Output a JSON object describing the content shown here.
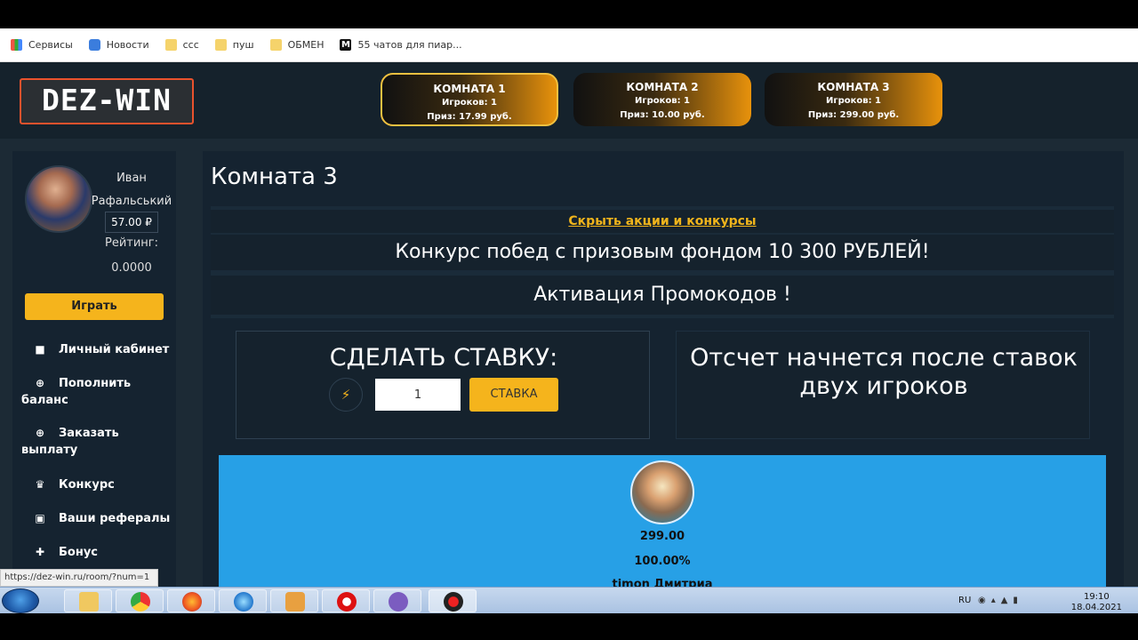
{
  "bookmarks": [
    {
      "label": "Сервисы",
      "icon": "apps-grid-icon"
    },
    {
      "label": "Новости",
      "icon": "news-icon"
    },
    {
      "label": "ccc",
      "icon": "folder-icon"
    },
    {
      "label": "пуш",
      "icon": "folder-icon"
    },
    {
      "label": "ОБМЕН",
      "icon": "folder-icon"
    },
    {
      "label": "55 чатов для пиар...",
      "icon": "medium-icon"
    }
  ],
  "site": {
    "logo": "DEZ-WIN",
    "rooms": [
      {
        "title": "КОМНАТА 1",
        "players": "Игроков: 1",
        "prize": "Приз: 17.99 руб.",
        "active": true
      },
      {
        "title": "КОМНАТА 2",
        "players": "Игроков: 1",
        "prize": "Приз: 10.00 руб.",
        "active": false
      },
      {
        "title": "КОМНАТА 3",
        "players": "Игроков: 1",
        "prize": "Приз: 299.00 руб.",
        "active": false
      }
    ]
  },
  "user": {
    "first_name": "Иван",
    "last_name": "Рафальський",
    "balance": "57.00 ₽",
    "rating_label": "Рейтинг:",
    "rating_value": "0.0000",
    "play_button": "Играть"
  },
  "menu": [
    {
      "label": "Личный кабинет",
      "icon": "briefcase-icon",
      "glyph": "💼"
    },
    {
      "label": "Пополнить баланс",
      "icon": "plus-circle-icon",
      "glyph": "⊕"
    },
    {
      "label": "Заказать выплату",
      "icon": "plus-circle-icon",
      "glyph": "⊕"
    },
    {
      "label": "Конкурс",
      "icon": "trophy-icon",
      "glyph": "🏆"
    },
    {
      "label": "Ваши рефералы",
      "icon": "money-icon",
      "glyph": "▣"
    },
    {
      "label": "Бонус",
      "icon": "gift-icon",
      "glyph": "🎁"
    }
  ],
  "main": {
    "room_title": "Комната 3",
    "hide_promos": "Скрыть акции и конкурсы",
    "promo_contest": "Конкурс побед с призовым фондом 10 300 РУБЛЕЙ!",
    "promo_codes": "Активация Промокодов !",
    "bet_title": "СДЕЛАТЬ СТАВКУ:",
    "bet_value": "1",
    "bet_button": "СТАВКА",
    "countdown_text": "Отсчет начнется после ставок двух игроков"
  },
  "player": {
    "amount": "299.00 ",
    "chance": "100.00%",
    "name": "timon Дмитриа"
  },
  "status_url": "https://dez-win.ru/room/?num=1",
  "taskbar": {
    "lang": "RU",
    "time": "19:10",
    "date": "18.04.2021"
  }
}
